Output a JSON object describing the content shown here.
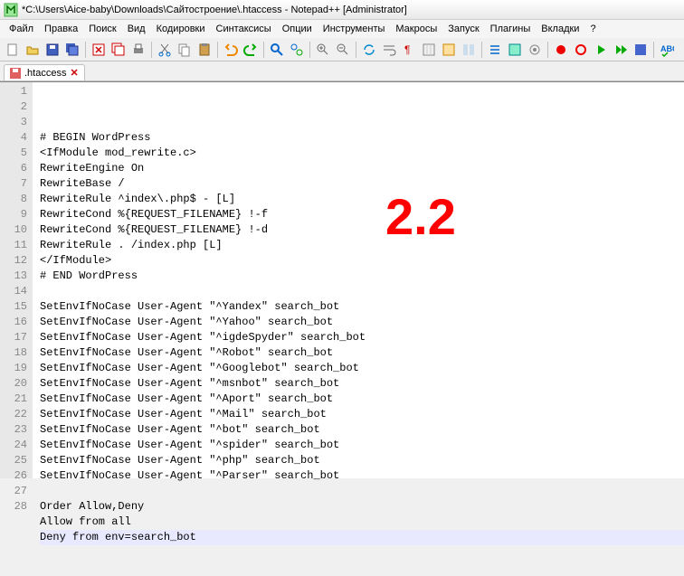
{
  "window": {
    "title": "*C:\\Users\\Aice-baby\\Downloads\\Сайтостроение\\.htaccess - Notepad++ [Administrator]"
  },
  "menu": {
    "items": [
      "Файл",
      "Правка",
      "Поиск",
      "Вид",
      "Кодировки",
      "Синтаксисы",
      "Опции",
      "Инструменты",
      "Макросы",
      "Запуск",
      "Плагины",
      "Вкладки",
      "?"
    ]
  },
  "tab": {
    "label": ".htaccess",
    "close": "✕"
  },
  "annotation": {
    "text": "2.2"
  },
  "code": {
    "lines": [
      "",
      "# BEGIN WordPress",
      "<IfModule mod_rewrite.c>",
      "RewriteEngine On",
      "RewriteBase /",
      "RewriteRule ^index\\.php$ - [L]",
      "RewriteCond %{REQUEST_FILENAME} !-f",
      "RewriteCond %{REQUEST_FILENAME} !-d",
      "RewriteRule . /index.php [L]",
      "</IfModule>",
      "# END WordPress",
      "",
      "SetEnvIfNoCase User-Agent \"^Yandex\" search_bot",
      "SetEnvIfNoCase User-Agent \"^Yahoo\" search_bot",
      "SetEnvIfNoCase User-Agent \"^igdeSpyder\" search_bot",
      "SetEnvIfNoCase User-Agent \"^Robot\" search_bot",
      "SetEnvIfNoCase User-Agent \"^Googlebot\" search_bot",
      "SetEnvIfNoCase User-Agent \"^msnbot\" search_bot",
      "SetEnvIfNoCase User-Agent \"^Aport\" search_bot",
      "SetEnvIfNoCase User-Agent \"^Mail\" search_bot",
      "SetEnvIfNoCase User-Agent \"^bot\" search_bot",
      "SetEnvIfNoCase User-Agent \"^spider\" search_bot",
      "SetEnvIfNoCase User-Agent \"^php\" search_bot",
      "SetEnvIfNoCase User-Agent \"^Parser\" search_bot",
      "",
      "Order Allow,Deny",
      "Allow from all",
      "Deny from env=search_bot"
    ]
  }
}
